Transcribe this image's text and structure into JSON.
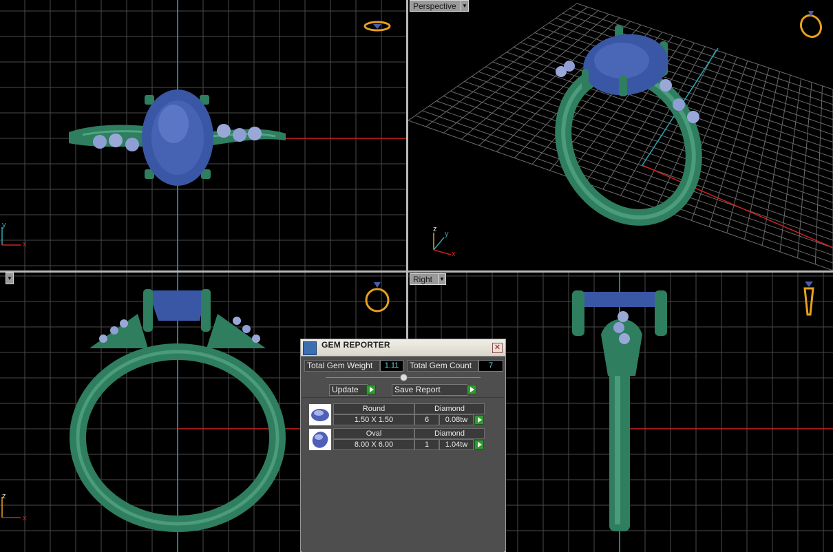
{
  "viewports": {
    "top_left": {
      "axes": [
        "y",
        "x"
      ]
    },
    "top_right": {
      "label": "Perspective",
      "axes": [
        "z",
        "y",
        "x"
      ]
    },
    "bottom_left": {
      "axes": [
        "z",
        "x"
      ]
    },
    "bottom_right": {
      "label": "Right"
    }
  },
  "gem_reporter": {
    "title": "GEM REPORTER",
    "close_glyph": "✕",
    "total_gem_weight_label": "Total Gem Weight",
    "total_gem_weight": "1.11",
    "total_gem_count_label": "Total Gem Count",
    "total_gem_count": "7",
    "update_label": "Update",
    "save_report_label": "Save Report",
    "gems": [
      {
        "shape": "Round",
        "material": "Diamond",
        "size": "1.50 X 1.50",
        "count": "6",
        "weight": "0.08tw"
      },
      {
        "shape": "Oval",
        "material": "Diamond",
        "size": "8.00 X 6.00",
        "count": "1",
        "weight": "1.04tw"
      }
    ]
  },
  "colors": {
    "ring_green": "#2e7e5f",
    "gem_blue": "#3a57a6",
    "side_stone": "#9aa8d8",
    "axis_red": "#d42020",
    "axis_cyan": "#2aa8b8",
    "icon_orange": "#e8a020"
  }
}
